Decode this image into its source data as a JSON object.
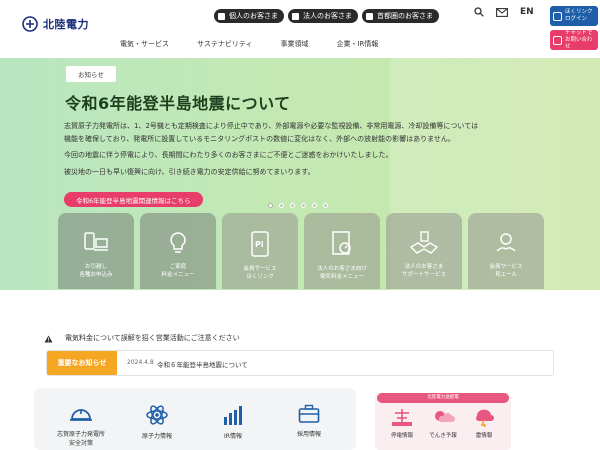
{
  "header": {
    "logo_text": "北陸電力",
    "customers": [
      {
        "label": "個人のお客さま"
      },
      {
        "label": "法人のお客さま"
      },
      {
        "label": "首都圏のお客さま"
      }
    ],
    "lang": "EN",
    "nav": [
      "電気・サービス",
      "サステナビリティ",
      "事業領域",
      "企業・IR情報"
    ],
    "hoku_btn": "ほくリンク\nログイン",
    "chat_btn": "チャットで\nお問い合わせ"
  },
  "hero": {
    "tag": "お知らせ",
    "title": "令和6年能登半島地震について",
    "paragraphs": [
      "志賀原子力発電所は、1、2号機とも定期検査により停止中であり、外部電源や必要な監視設備、非常用電源、冷却設備等については機能を確保しており、発電所に設置しているモニタリングポストの数値に変化はなく、外部への放射能の影響はありません。",
      "今回の地震に伴う停電により、長期間にわたり多くのお客さまにご不便とご迷惑をおかけいたしました。",
      "被災地の一日も早い復興に向け、引き続き電力の安定供給に努めてまいります。"
    ],
    "button": "令和6年能登半島地震関連情報はこちら",
    "slide_count": 6,
    "active_slide": 0
  },
  "tiles": [
    {
      "label": "お引越し\n各種お申込み",
      "icon": "phone-laptop-icon"
    },
    {
      "label": "ご家庭\n料金メニュー",
      "icon": "lightbulb-icon"
    },
    {
      "label": "会員サービス\nほくリンク",
      "icon": "smartphone-pi-icon"
    },
    {
      "label": "法人のお客さま向け\n電気料金メニュー",
      "icon": "document-gauge-icon"
    },
    {
      "label": "法人のお客さま\nサポートサービス",
      "icon": "handshake-building-icon"
    },
    {
      "label": "会員サービス\n見エール",
      "icon": "hand-bulb-icon"
    }
  ],
  "alert": {
    "text": "電気料金について誤解を招く営業活動にご注意ください"
  },
  "news": {
    "tag": "重要なお知らせ",
    "date": "2024.4.8",
    "title": "令和６年能登半島地震について"
  },
  "quick_links": [
    {
      "label": "志賀原子力発電所\n安全対策",
      "icon": "helmet-icon"
    },
    {
      "label": "原子力情報",
      "icon": "atom-icon"
    },
    {
      "label": "IR情報",
      "icon": "bar-chart-icon"
    },
    {
      "label": "採用情報",
      "icon": "briefcase-icon"
    }
  ],
  "right_panel": {
    "head": "北陸電力送配電",
    "links": [
      {
        "label": "停電情報",
        "icon": "outage-icon"
      },
      {
        "label": "でんき予報",
        "icon": "forecast-icon"
      },
      {
        "label": "雷情報",
        "icon": "lightning-icon"
      }
    ]
  },
  "colors": {
    "brand_navy": "#1a2e7a",
    "accent_pink": "#e83c6a",
    "notice_orange": "#f5a623",
    "hero_green": "#c3e8b4"
  }
}
